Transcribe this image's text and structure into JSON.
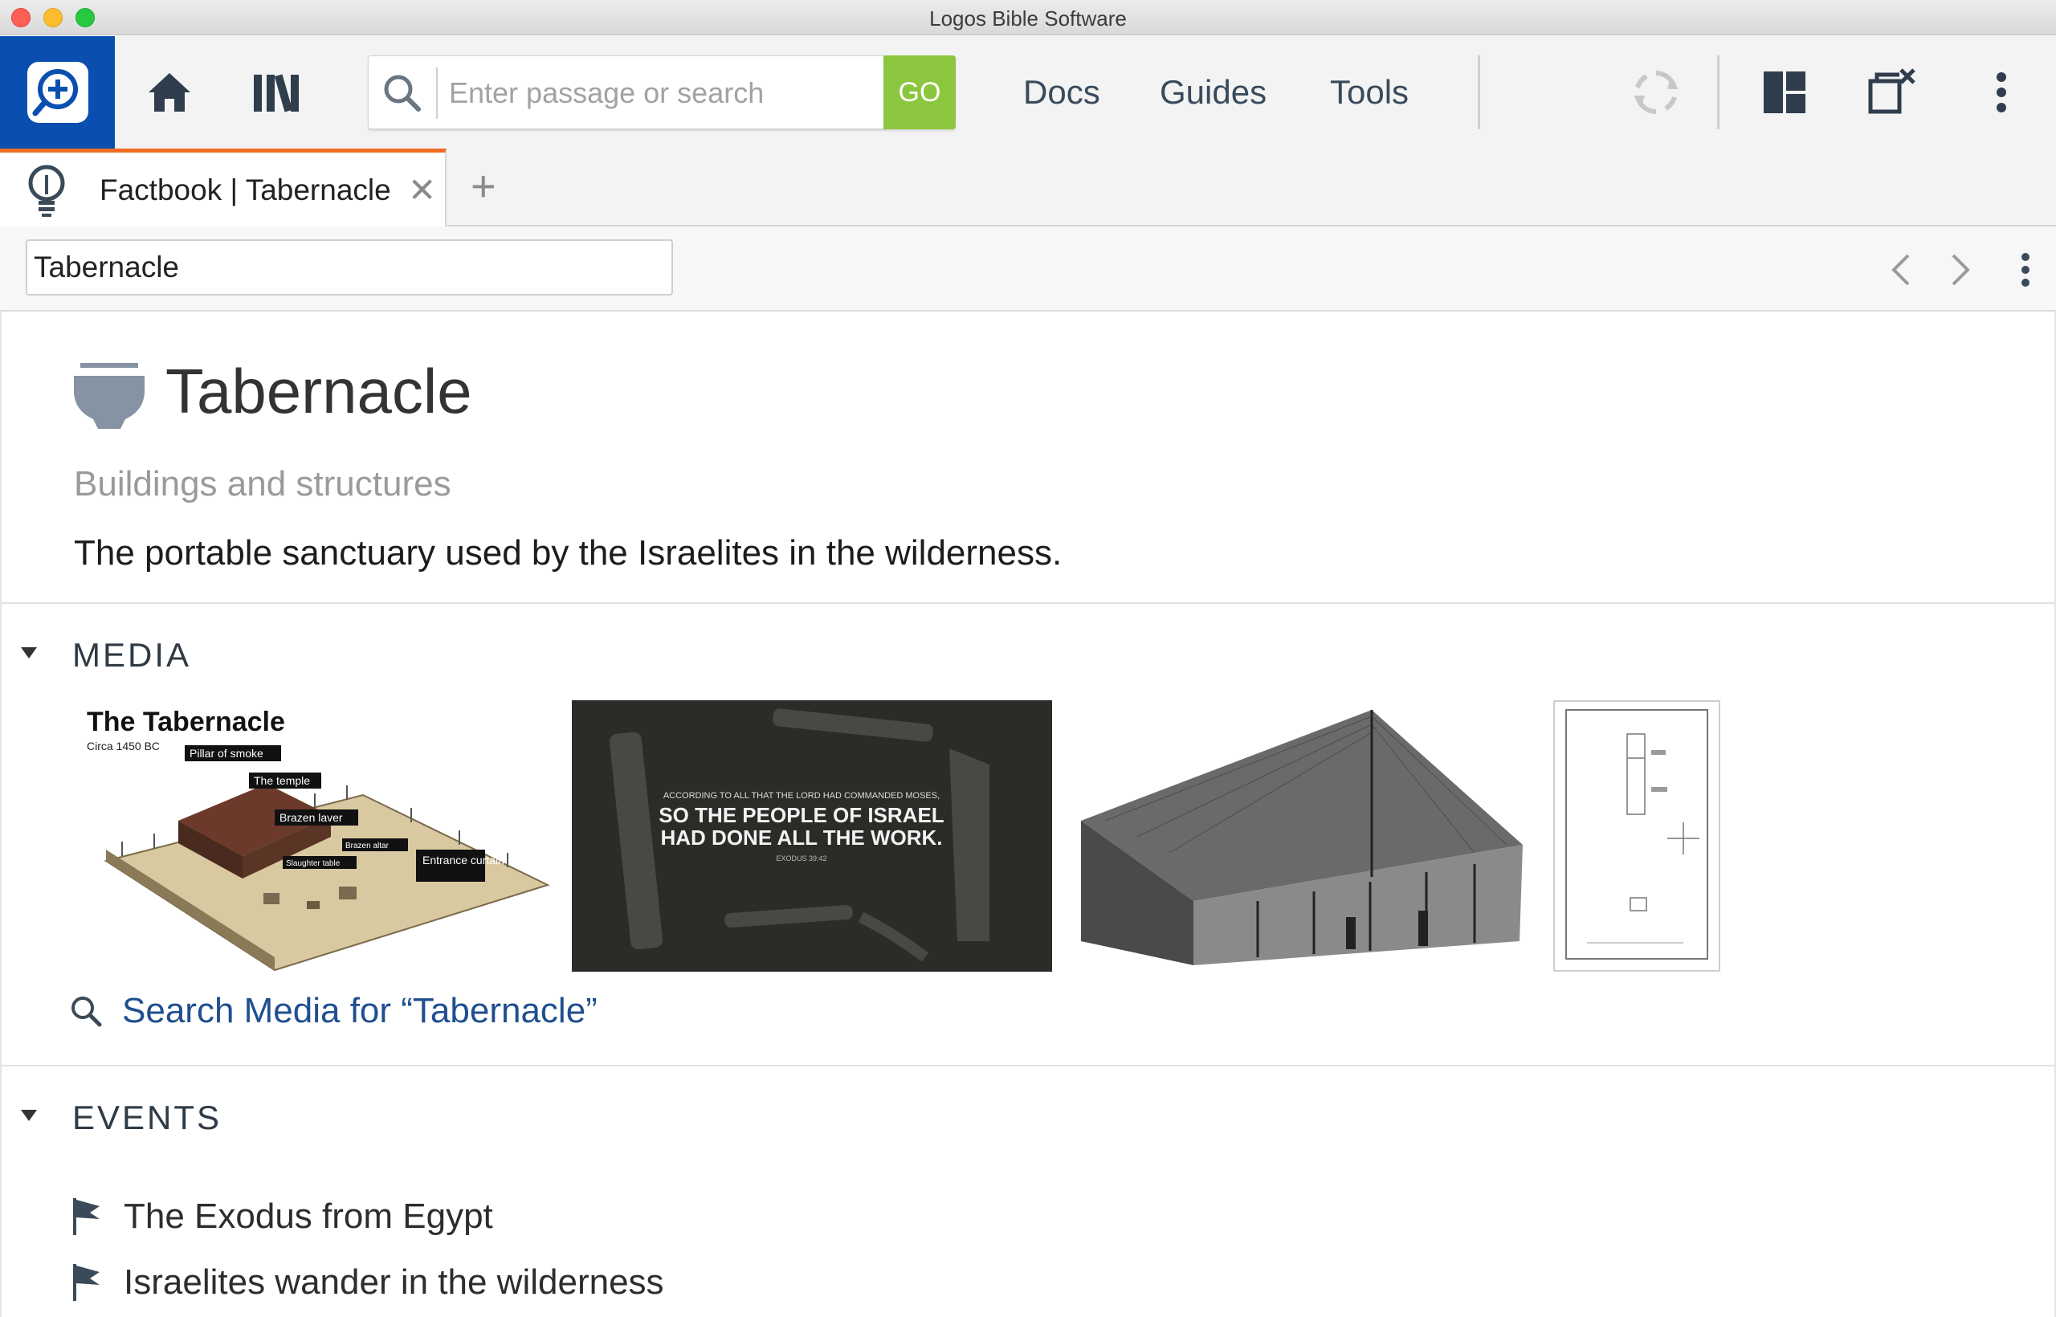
{
  "window": {
    "title": "Logos Bible Software"
  },
  "toolbar": {
    "search_placeholder": "Enter passage or search",
    "go_label": "GO",
    "menu": [
      {
        "label": "Docs"
      },
      {
        "label": "Guides"
      },
      {
        "label": "Tools"
      }
    ],
    "icons": [
      "logos-logo-icon",
      "home-icon",
      "library-icon",
      "search-icon",
      "sync-icon",
      "layouts-icon",
      "close-all-panels-icon",
      "more-options-icon"
    ]
  },
  "tabs": [
    {
      "label": "Factbook | Tabernacle",
      "icon": "lightbulb-icon",
      "active": true
    }
  ],
  "panel": {
    "topic_input_value": "Tabernacle"
  },
  "topic": {
    "title": "Tabernacle",
    "category": "Buildings and structures",
    "description": "The portable sanctuary used by the Israelites in the wilderness.",
    "icon": "basin-icon"
  },
  "media": {
    "heading": "MEDIA",
    "thumbnails": [
      {
        "kind": "infographic",
        "title": "The Tabernacle",
        "subtitle": "Circa 1450 BC",
        "callouts": [
          "Pillar of smoke",
          "The temple",
          "Brazen laver",
          "Brazen altar",
          "Slaughter table",
          "Entrance curtain"
        ]
      },
      {
        "kind": "quote-image",
        "small_text": "ACCORDING TO ALL THAT THE LORD HAD COMMANDED MOSES,",
        "big_text_1": "SO THE PEOPLE OF ISRAEL",
        "big_text_2": "HAD DONE ALL THE WORK.",
        "reference": "EXODUS 39:42"
      },
      {
        "kind": "engraving"
      },
      {
        "kind": "floor-plan"
      }
    ],
    "search_link": "Search Media for “Tabernacle”"
  },
  "events": {
    "heading": "EVENTS",
    "items": [
      {
        "label": "The Exodus from Egypt"
      },
      {
        "label": "Israelites wander in the wilderness"
      }
    ]
  },
  "colors": {
    "brand_blue": "#0a4fb0",
    "go_green": "#8cc63f",
    "tab_accent": "#f26c21",
    "link_blue": "#1f4f8f"
  }
}
